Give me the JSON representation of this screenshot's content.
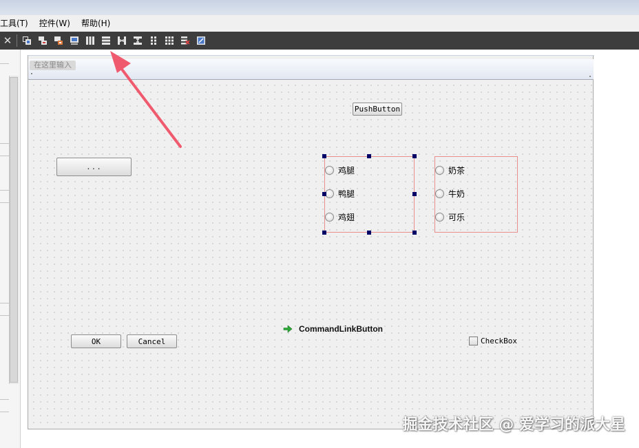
{
  "menu": {
    "items": [
      "工具(T)",
      "控件(W)",
      "帮助(H)"
    ]
  },
  "toolbar": {
    "close_glyph": "✕",
    "icons": [
      "edit-widgets-icon",
      "edit-signals-slots-icon",
      "edit-buddies-icon",
      "edit-tab-order-icon",
      "layout-horizontal-icon",
      "layout-vertical-icon",
      "layout-horizontal-splitter-icon",
      "layout-vertical-splitter-icon",
      "layout-form-icon",
      "layout-grid-icon",
      "break-layout-icon",
      "adjust-size-icon"
    ]
  },
  "form": {
    "menu_placeholder": "在这里输入",
    "push_button": "PushButton",
    "tool_button": "...",
    "ok_button": "OK",
    "cancel_button": "Cancel",
    "command_link": "CommandLinkButton",
    "checkbox": "CheckBox",
    "group_food": [
      "鸡腿",
      "鸭腿",
      "鸡翅"
    ],
    "group_drink": [
      "奶茶",
      "牛奶",
      "可乐"
    ]
  },
  "watermark": "掘金技术社区 @ 爱学习的派大星",
  "colors": {
    "toolbar_bg": "#3d3d3d",
    "annotation_arrow": "#f05a6e",
    "selection_handle": "#000066",
    "group_border": "#e88d8d"
  }
}
